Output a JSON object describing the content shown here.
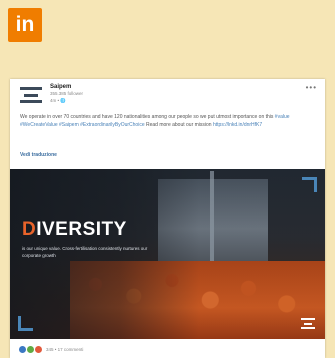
{
  "linkedin_badge": {
    "label": "in"
  },
  "post": {
    "company_name": "Saipem",
    "followers": "355.385 follower",
    "post_age": "4m • 🌐",
    "more_label": "•••",
    "text_plain": "We operate in over 70 countries and have 120 nationalities among our people so we put utmost importance on this ",
    "hashtags": "#value #WeCreateValue #Saipem #ExtraordinarilyByOurChoice",
    "text_tail": " Read more about our mission ",
    "link": "https://lnkd.in/dnrHfK7",
    "translate_label": "Vedi traduzione",
    "image": {
      "title_first_letter": "D",
      "title_rest": "IVERSITY",
      "subtitle": "is our unique value. Cross-fertilisation consistently nurtures our corporate growth"
    },
    "reactions": {
      "icons": [
        "like-icon",
        "celebrate-icon",
        "love-icon"
      ],
      "colors": [
        "#3b78c2",
        "#5faa44",
        "#e25a3c"
      ],
      "count": "345 • 17 commenti"
    }
  },
  "colors": {
    "background": "#f6e6b6",
    "badge": "#f07d00",
    "accent_orange": "#e8632a",
    "frame_blue": "#4a86b8"
  }
}
